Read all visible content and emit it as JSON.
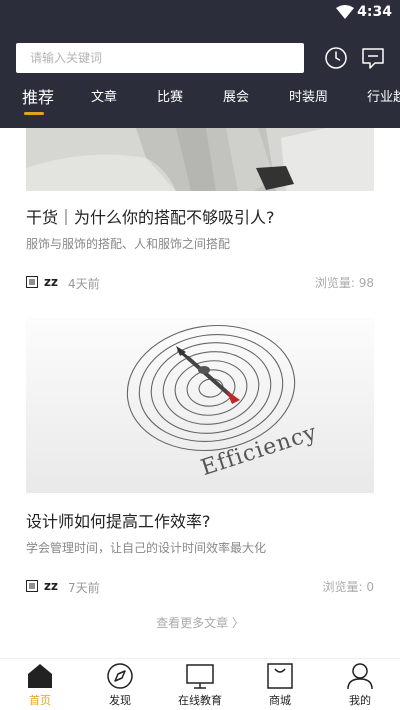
{
  "status_bar": {
    "time": "4:34"
  },
  "search": {
    "placeholder": "请输入关键词",
    "value": ""
  },
  "tabs": [
    {
      "label": "推荐",
      "active": true
    },
    {
      "label": "文章"
    },
    {
      "label": "比赛"
    },
    {
      "label": "展会"
    },
    {
      "label": "时装周"
    },
    {
      "label": "行业趋"
    }
  ],
  "articles": [
    {
      "title": "干货｜为什么你的搭配不够吸引人?",
      "description": "服饰与服饰的搭配、人和服饰之间搭配",
      "author": "zz",
      "time": "4天前",
      "views": "浏览量: 98"
    },
    {
      "title": "设计师如何提高工作效率?",
      "description": "学会管理时间，让自己的设计时间效率最大化",
      "author": "zz",
      "time": "7天前",
      "views": "浏览量: 0",
      "image_text": "Efficiency"
    }
  ],
  "more_link": "查看更多文章 〉",
  "bottom_nav": [
    {
      "label": "首页",
      "icon": "home-icon",
      "active": true
    },
    {
      "label": "发现",
      "icon": "compass-icon"
    },
    {
      "label": "在线教育",
      "icon": "monitor-icon"
    },
    {
      "label": "商城",
      "icon": "shopping-bag-icon"
    },
    {
      "label": "我的",
      "icon": "user-icon"
    }
  ],
  "colors": {
    "header_bg": "#2b2d3a",
    "accent": "#e0a423"
  }
}
